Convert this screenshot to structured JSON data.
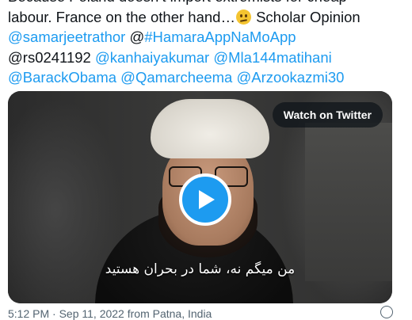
{
  "tweet": {
    "lines": [
      [
        {
          "t": "Because Poland doesn’t import extremists for cheap",
          "c": "plain"
        }
      ],
      [
        {
          "t": "labour. France on the other hand…",
          "c": "plain"
        },
        {
          "emoji": "confused-face-icon"
        },
        {
          "t": " Scholar Opinion",
          "c": "plain"
        }
      ],
      [
        {
          "t": "@samarjeetrathor",
          "c": "mention"
        },
        {
          "t": " @",
          "c": "plain"
        },
        {
          "t": "#HamaraAppNaMoApp",
          "c": "mention"
        }
      ],
      [
        {
          "t": "@rs0241192 ",
          "c": "plain"
        },
        {
          "t": "@kanhaiyakumar",
          "c": "mention"
        },
        {
          "t": " ",
          "c": "plain"
        },
        {
          "t": "@Mla144matihani",
          "c": "mention"
        }
      ],
      [
        {
          "t": "@BarackObama",
          "c": "mention"
        },
        {
          "t": " ",
          "c": "plain"
        },
        {
          "t": "@Qamarcheema",
          "c": "mention"
        },
        {
          "t": " ",
          "c": "plain"
        },
        {
          "t": "@Arzookazmi30",
          "c": "mention"
        }
      ]
    ]
  },
  "media": {
    "watch_label": "Watch on Twitter",
    "play_icon": "play-icon",
    "caption": "من میگم نه، شما در بحران هستید"
  },
  "meta": {
    "text": "5:12 PM · Sep 11, 2022 from Patna, India",
    "info_icon": "info-icon"
  },
  "colors": {
    "mention": "#1d9bf0",
    "text": "#0f1419",
    "play": "#1d9bf0"
  }
}
